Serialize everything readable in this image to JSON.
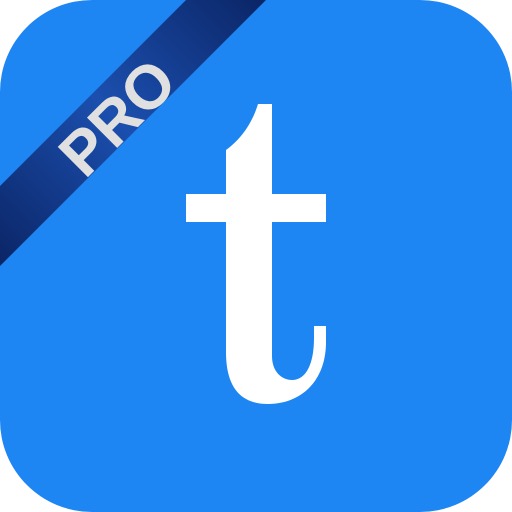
{
  "app_icon": {
    "brand_letter": "t",
    "badge_text": "PRO",
    "colors": {
      "tile_background": "#1e86f2",
      "letter": "#ffffff",
      "ribbon_dark": "#0d2a6b",
      "ribbon_light": "#1a4aa8",
      "badge_text": "#e0e0e0"
    }
  }
}
